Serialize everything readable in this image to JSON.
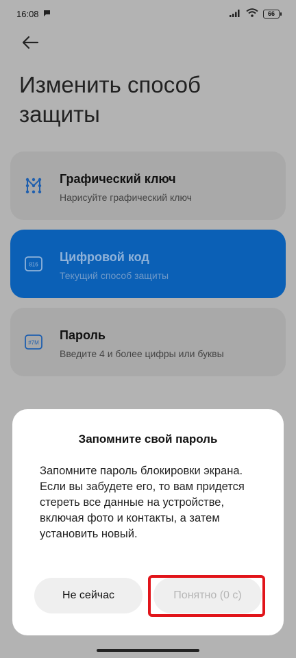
{
  "status_bar": {
    "time": "16:08",
    "battery": "66",
    "icons": [
      "chat-bubble-icon",
      "signal-icon",
      "wifi-icon",
      "battery-icon"
    ]
  },
  "header": {
    "back_icon": "arrow-left-icon",
    "title": "Изменить способ защиты"
  },
  "options": [
    {
      "title": "Графический ключ",
      "subtitle": "Нарисуйте графический ключ",
      "icon": "pattern-icon",
      "selected": false
    },
    {
      "title": "Цифровой код",
      "subtitle": "Текущий способ защиты",
      "icon": "pin-icon",
      "icon_text": "816",
      "selected": true
    },
    {
      "title": "Пароль",
      "subtitle": "Введите 4 и более цифры или буквы",
      "icon": "password-icon",
      "icon_text": "#7M",
      "selected": false
    }
  ],
  "dialog": {
    "title": "Запомните свой пароль",
    "message": "Запомните пароль блокировки экрана. Если вы забудете его, то вам придется стереть все данные на устройстве, включая фото и контакты, а затем установить новый.",
    "cancel_label": "Не сейчас",
    "ok_label": "Понятно (0 с)"
  },
  "colors": {
    "accent": "#0b60b6",
    "highlight": "#e1141a"
  }
}
